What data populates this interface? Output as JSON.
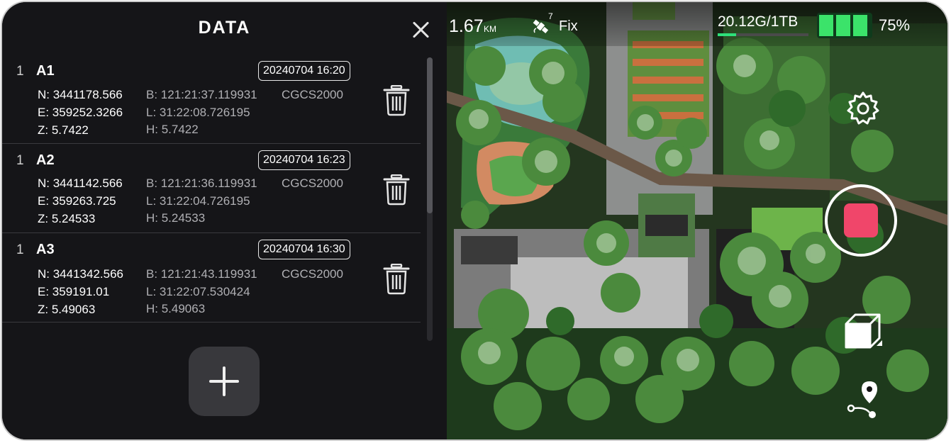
{
  "panel": {
    "title": "DATA"
  },
  "records": [
    {
      "index": "1",
      "name": "A1",
      "time": "20240704 16:20",
      "n": "N: 3441178.566",
      "e": "E: 359252.3266",
      "z": "Z: 5.7422",
      "b": "B: 121:21:37.119931",
      "l": "L: 31:22:08.726195",
      "h": "H: 5.7422",
      "crs": "CGCS2000"
    },
    {
      "index": "1",
      "name": "A2",
      "time": "20240704 16:23",
      "n": "N: 3441142.566",
      "e": "E: 359263.725",
      "z": "Z: 5.24533",
      "b": "B: 121:21:36.119931",
      "l": "L: 31:22:04.726195",
      "h": "H: 5.24533",
      "crs": "CGCS2000"
    },
    {
      "index": "1",
      "name": "A3",
      "time": "20240704 16:30",
      "n": "N: 3441342.566",
      "e": "E: 359191.01",
      "z": "Z: 5.49063",
      "b": "B: 121:21:43.119931",
      "l": "L: 31:22:07.530424",
      "h": "H: 5.49063",
      "crs": "CGCS2000"
    }
  ],
  "status": {
    "distance": "1.67",
    "distance_unit": "KM",
    "satellites": "7",
    "fix": "Fix",
    "storage": "20.12G/1TB",
    "storage_fraction": 0.2,
    "battery": "75%",
    "battery_fraction": 0.75
  },
  "colors": {
    "record_accent": "#f0466a",
    "storage_bar": "#2ee07a",
    "battery": "#3be36a"
  },
  "icons": {
    "settings": "gear-icon",
    "record": "record-stop-icon",
    "view": "cube-view-icon",
    "route": "location-route-icon",
    "satellite": "satellite-icon",
    "delete": "trash-icon",
    "add": "plus-icon",
    "close": "close-icon"
  }
}
